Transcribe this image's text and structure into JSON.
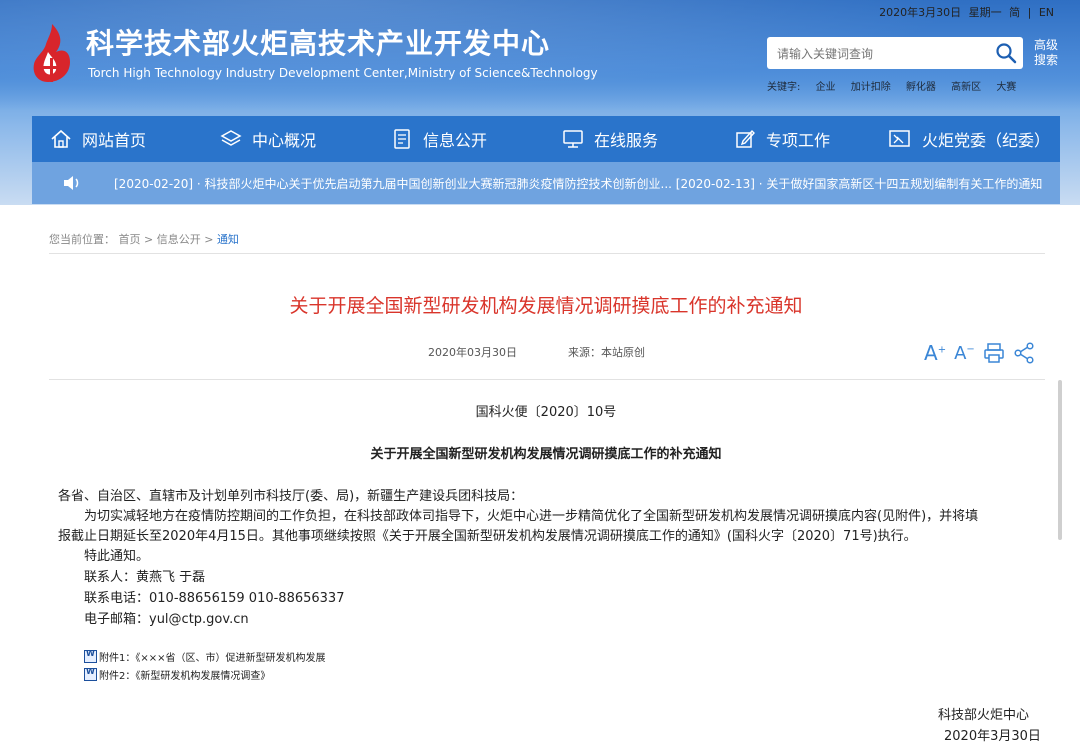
{
  "header": {
    "date": "2020年3月30日",
    "weekday": "星期一",
    "lang_simplified": "简",
    "lang_en": "EN",
    "separator": "|",
    "title": "科学技术部火炬高技术产业开发中心",
    "subtitle": "Torch High Technology Industry Development Center,Ministry of Science&Technology",
    "search_placeholder": "请输入关键词查询",
    "advanced_search_1": "高级",
    "advanced_search_2": "搜索",
    "keywords_label": "关键字:",
    "keywords": [
      "企业",
      "加计扣除",
      "孵化器",
      "高新区",
      "大赛"
    ],
    "logo_color": "#d8252b"
  },
  "nav": {
    "items": [
      {
        "label": "网站首页",
        "icon": "home-icon"
      },
      {
        "label": "中心概况",
        "icon": "layers-icon"
      },
      {
        "label": "信息公开",
        "icon": "document-icon"
      },
      {
        "label": "在线服务",
        "icon": "monitor-icon"
      },
      {
        "label": "专项工作",
        "icon": "edit-icon"
      },
      {
        "label": "火炬党委（纪委）",
        "icon": "flag-icon"
      }
    ],
    "bg_color": "#2a74cb"
  },
  "ticker": {
    "text": "[2020-02-20] · 科技部火炬中心关于优先启动第九届中国创新创业大赛新冠肺炎疫情防控技术创新创业...  [2020-02-13] · 关于做好国家高新区十四五规划编制有关工作的通知"
  },
  "breadcrumb": {
    "label": "您当前位置：",
    "home": "首页",
    "sep1": ">",
    "section": "信息公开",
    "sep2": ">",
    "current": "通知"
  },
  "article": {
    "title": "关于开展全国新型研发机构发展情况调研摸底工作的补充通知",
    "date": "2020年03月30日",
    "source": "来源：本站原创",
    "font_large": "A",
    "font_small": "A",
    "doc_no": "国科火便〔2020〕10号",
    "doc_title": "关于开展全国新型研发机构发展情况调研摸底工作的补充通知",
    "salutation": "各省、自治区、直辖市及计划单列市科技厅(委、局)，新疆生产建设兵团科技局：",
    "body_line1": "为切实减轻地方在疫情防控期间的工作负担，在科技部政体司指导下，火炬中心进一步精简优化了全国新型研发机构发展情况调研摸底内容(见附件)，并将填",
    "body_line2": "报截止日期延长至2020年4月15日。其他事项继续按照《关于开展全国新型研发机构发展情况调研摸底工作的通知》(国科火字〔2020〕71号)执行。",
    "closing": "特此通知。",
    "contact_person": "联系人：黄燕飞 于磊",
    "contact_phone": "联系电话：010-88656159 010-88656337",
    "contact_email": "电子邮箱：yul@ctp.gov.cn",
    "attachment1": "附件1：《×××省（区、市）促进新型研发机构发展",
    "attachment2": "附件2：《新型研发机构发展情况调查》",
    "signer": "科技部火炬中心",
    "sign_date": "2020年3月30日",
    "title_color": "#d9352b"
  }
}
